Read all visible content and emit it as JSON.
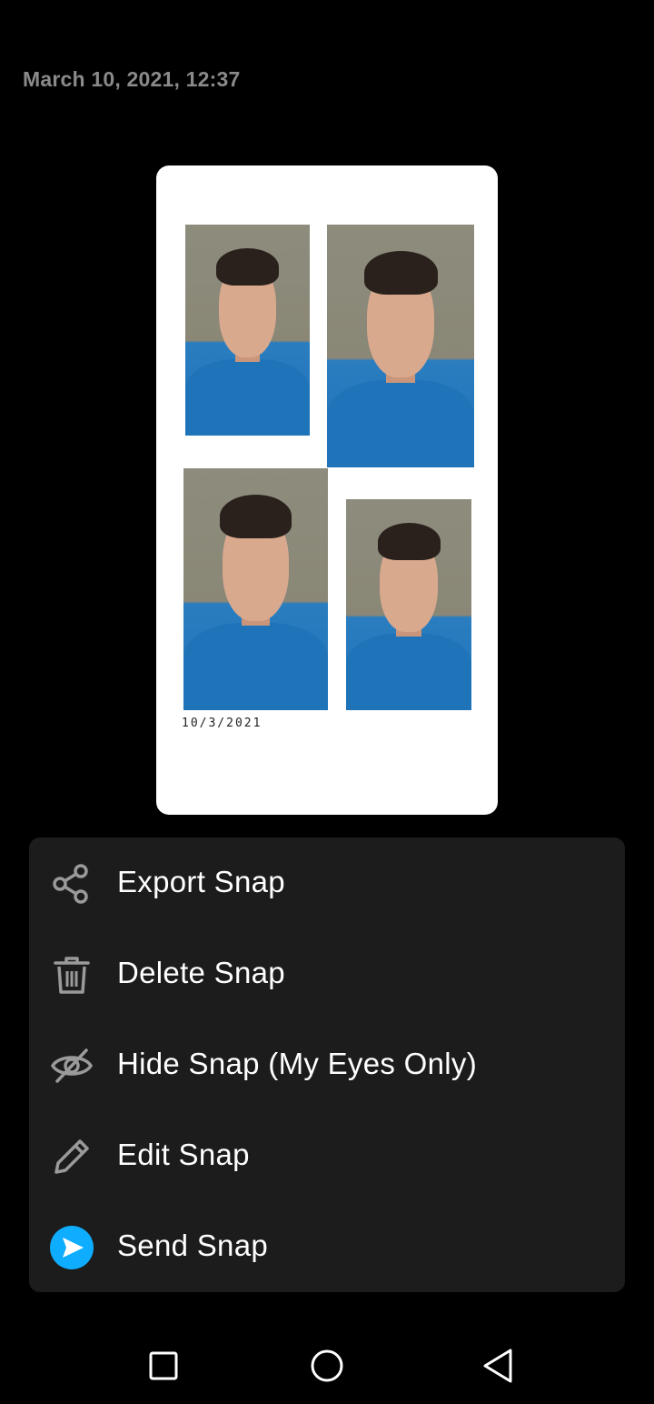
{
  "header": {
    "timestamp": "March 10, 2021, 12:37"
  },
  "snap": {
    "strip_date": "10/3/2021"
  },
  "menu": {
    "items": [
      {
        "label": "Export Snap",
        "icon": "share-icon"
      },
      {
        "label": "Delete Snap",
        "icon": "trash-icon"
      },
      {
        "label": "Hide Snap (My Eyes Only)",
        "icon": "eye-off-icon"
      },
      {
        "label": "Edit Snap",
        "icon": "pencil-icon"
      },
      {
        "label": "Send Snap",
        "icon": "send-icon"
      }
    ]
  },
  "colors": {
    "background": "#000000",
    "menu_background": "#1c1c1c",
    "send_accent": "#0fadff",
    "icon_gray": "#9a9a9a",
    "timestamp_gray": "#8a8a8a"
  },
  "navbar": {
    "buttons": [
      "recents-square-icon",
      "home-circle-icon",
      "back-triangle-icon"
    ]
  }
}
